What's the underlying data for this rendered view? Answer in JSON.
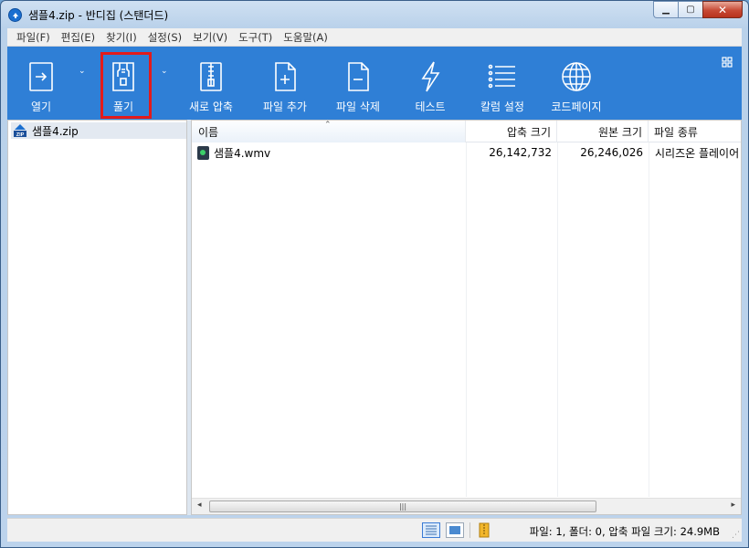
{
  "window": {
    "title": "샘플4.zip - 반디집 (스탠더드)"
  },
  "menu": [
    {
      "label": "파일(F)"
    },
    {
      "label": "편집(E)"
    },
    {
      "label": "찾기(I)"
    },
    {
      "label": "설정(S)"
    },
    {
      "label": "보기(V)"
    },
    {
      "label": "도구(T)"
    },
    {
      "label": "도움말(A)"
    }
  ],
  "toolbar": {
    "buttons": [
      {
        "label": "열기",
        "icon": "open-icon"
      },
      {
        "label": "풀기",
        "icon": "extract-icon"
      },
      {
        "label": "새로 압축",
        "icon": "new-archive-icon"
      },
      {
        "label": "파일 추가",
        "icon": "add-file-icon"
      },
      {
        "label": "파일 삭제",
        "icon": "delete-file-icon"
      },
      {
        "label": "테스트",
        "icon": "test-icon"
      },
      {
        "label": "칼럼 설정",
        "icon": "column-settings-icon"
      },
      {
        "label": "코드페이지",
        "icon": "codepage-icon"
      }
    ],
    "accent_color": "#2f7fd6",
    "highlight_color": "#e31b1b"
  },
  "tree": {
    "items": [
      {
        "label": "샘플4.zip",
        "icon": "zip-icon"
      }
    ]
  },
  "file_list": {
    "columns": [
      "이름",
      "압축 크기",
      "원본 크기",
      "파일 종류"
    ],
    "rows": [
      {
        "name": "샘플4.wmv",
        "compressed": "26,142,732",
        "original": "26,246,026",
        "type": "시리즈온 플레이어"
      }
    ]
  },
  "statusbar": {
    "text": "파일: 1, 폴더: 0, 압축 파일 크기: 24.9MB"
  }
}
